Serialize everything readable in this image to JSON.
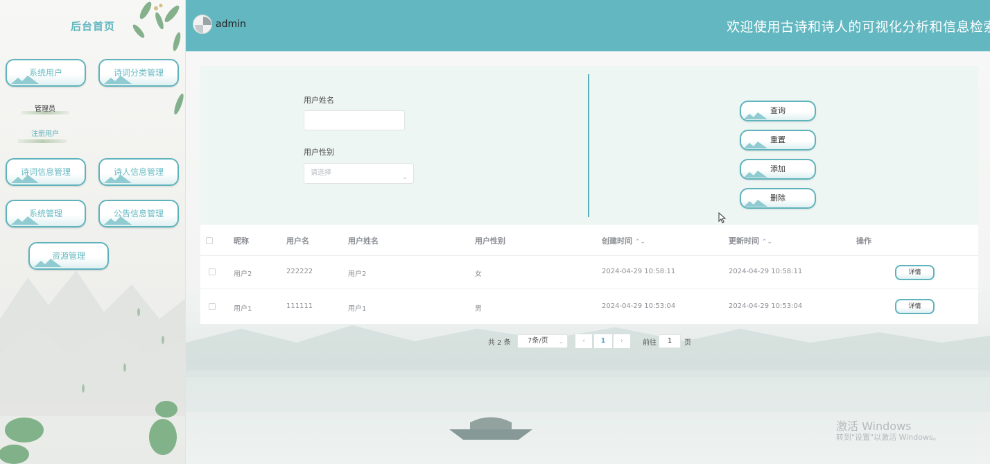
{
  "sidebar": {
    "title": "后台首页",
    "menu": [
      {
        "label": "系统用户"
      },
      {
        "label": "诗词分类管理"
      },
      {
        "label": "诗词信息管理"
      },
      {
        "label": "诗人信息管理"
      },
      {
        "label": "系统管理"
      },
      {
        "label": "公告信息管理"
      },
      {
        "label": "资源管理"
      }
    ],
    "sub_items": [
      {
        "label": "管理员"
      },
      {
        "label": "注册用户"
      }
    ]
  },
  "header": {
    "username": "admin",
    "welcome": "欢迎使用古诗和诗人的可视化分析和信息检索"
  },
  "search": {
    "name_label": "用户姓名",
    "name_value": "",
    "gender_label": "用户性别",
    "gender_placeholder": "请选择",
    "buttons": {
      "query": "查询",
      "reset": "重置",
      "add": "添加",
      "delete": "删除"
    }
  },
  "table": {
    "headers": {
      "nickname": "昵称",
      "username": "用户名",
      "real_name": "用户姓名",
      "gender": "用户性别",
      "created": "创建时间",
      "updated": "更新时间",
      "actions": "操作"
    },
    "sort_glyph": "⌃⌄",
    "rows": [
      {
        "nickname": "用户2",
        "username": "222222",
        "real_name": "用户2",
        "gender": "女",
        "created": "2024-04-29 10:58:11",
        "updated": "2024-04-29 10:58:11",
        "action": "详情"
      },
      {
        "nickname": "用户1",
        "username": "111111",
        "real_name": "用户1",
        "gender": "男",
        "created": "2024-04-29 10:53:04",
        "updated": "2024-04-29 10:53:04",
        "action": "详情"
      }
    ]
  },
  "pagination": {
    "total_text": "共 2 条",
    "page_size": "7条/页",
    "current_page": "1",
    "goto_label": "前往",
    "goto_value": "1",
    "page_suffix": "页"
  },
  "watermark": {
    "line1": "激活 Windows",
    "line2": "转到\"设置\"以激活 Windows。"
  },
  "colors": {
    "accent": "#62b7c0",
    "panel_bg": "#eef6f4",
    "link": "#5aa7d8"
  }
}
